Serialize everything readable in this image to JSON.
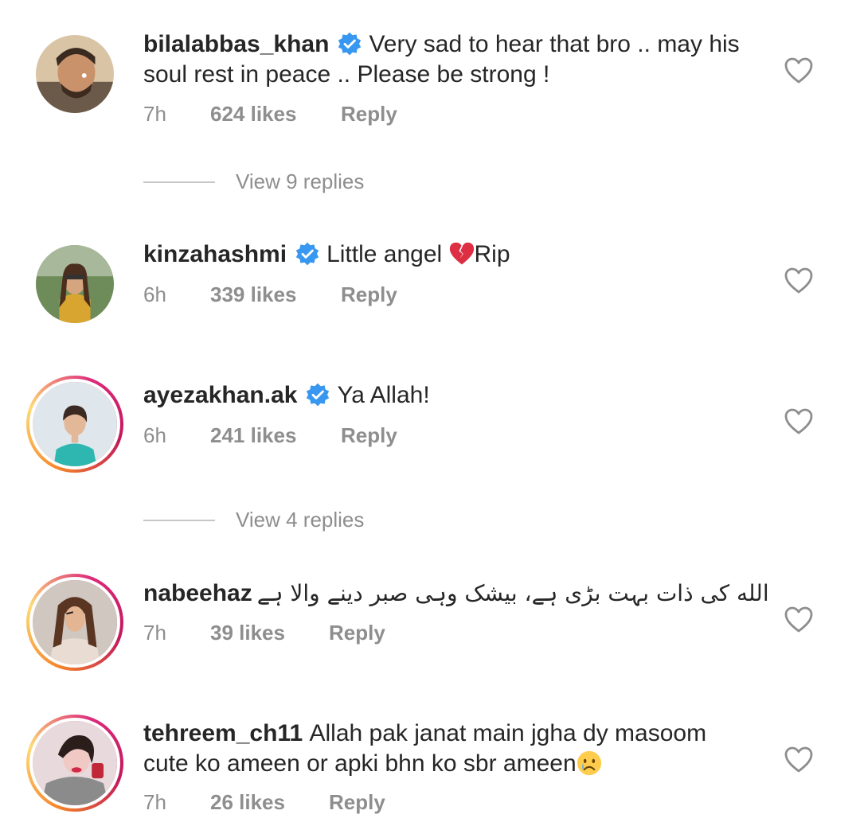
{
  "comments": [
    {
      "username": "bilalabbas_khan",
      "text": "Very sad to hear that bro .. may his",
      "text2": "soul rest in peace .. Please be strong !",
      "time": "7h",
      "likes": "624 likes",
      "reply": "Reply",
      "verified": true
    },
    {
      "username": "kinzahashmi",
      "text": "Little angel",
      "text_after_emoji": "Rip",
      "emoji": "broken-heart-emoji",
      "time": "6h",
      "likes": "339 likes",
      "reply": "Reply",
      "verified": true
    },
    {
      "username": "ayezakhan.ak",
      "text": "Ya Allah!",
      "time": "6h",
      "likes": "241 likes",
      "reply": "Reply",
      "verified": true
    },
    {
      "username": "nabeehaz",
      "text": "الله کی ذات بہت بڑی ہے، بیشک وہی صبر دینے والا ہے",
      "time": "7h",
      "likes": "39 likes",
      "reply": "Reply",
      "verified": false
    },
    {
      "username": "tehreem_ch11",
      "text": "Allah pak janat main jgha dy masoom",
      "text2": "cute ko ameen or apki bhn ko sbr ameen",
      "emoji": "crying-face-emoji",
      "time": "7h",
      "likes": "26 likes",
      "reply": "Reply",
      "verified": false
    }
  ],
  "view_replies": [
    {
      "label": "View 9 replies"
    },
    {
      "label": "View 4 replies"
    }
  ],
  "colors": {
    "text": "#262626",
    "secondary": "#8e8e8e",
    "verified_blue": "#3897f0",
    "divider": "#c7c7c7"
  }
}
